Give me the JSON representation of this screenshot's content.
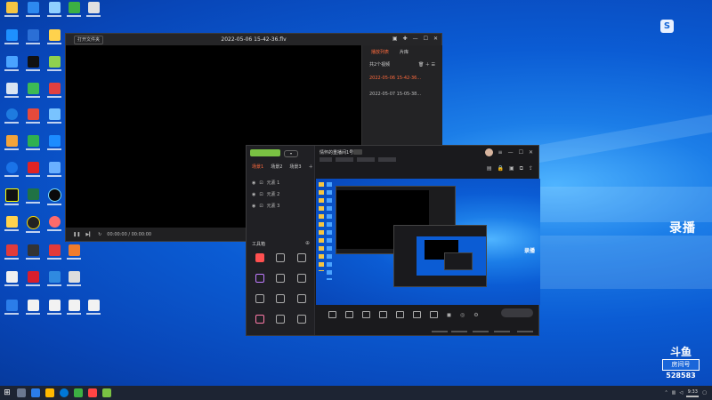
{
  "desktop": {
    "overlay_label": "录播",
    "watermark": {
      "brand": "斗鱼",
      "room_label": "房间号",
      "room_id": "528583"
    },
    "colors": {
      "wallpaper": "#0b5cd4",
      "accent": "#ff6a3d"
    }
  },
  "player": {
    "open_button": "打开文件夹",
    "title": "2022-05-06 15-42-36.flv",
    "tabs": [
      "播放列表",
      "片库"
    ],
    "list_header": "共2个视频",
    "playlist": [
      "2022-05-06 15-42-36...",
      "2022-05-07 15-05-38..."
    ],
    "time_display": "00:00:00 / 00:00:00"
  },
  "streamer": {
    "tabs": [
      "场景1",
      "场景2",
      "场景3"
    ],
    "scene_items": [
      "元素 1",
      "元素 2",
      "元素 3"
    ],
    "tools_title": "工具箱",
    "room_name": "情怀的重播间1号",
    "taskbar_time": "9:33"
  }
}
